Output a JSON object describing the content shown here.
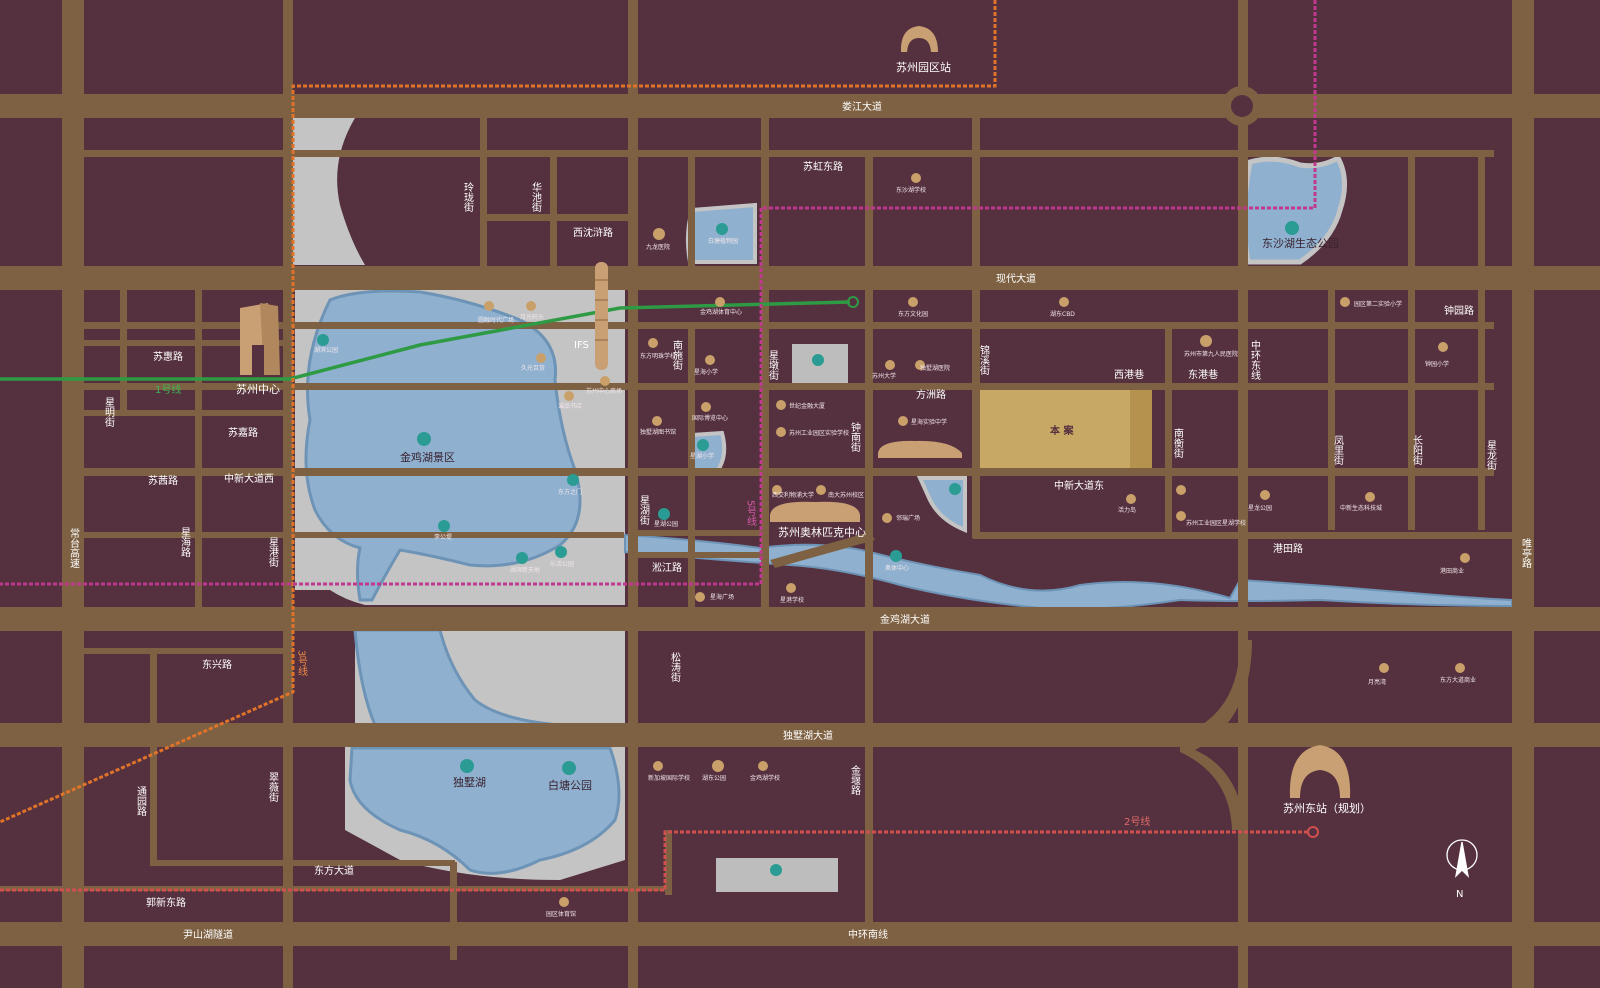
{
  "map": {
    "compass_letter": "N",
    "project_label": "本 案",
    "ifs_label": "IFS",
    "colors": {
      "background": "#55303e",
      "road": "#7e6142",
      "lake": "#8fb1cf",
      "lake_edge": "#6d93b6",
      "park": "#c4c4c4",
      "project": "#c8a865",
      "metro_line_1": "#2f9a44",
      "metro_line_2": "#d24f4f",
      "metro_line_3": "#e0732a",
      "metro_line_5": "#c0398f"
    },
    "roads_major": [
      "娄江大道",
      "现代大道",
      "金鸡湖大道",
      "独墅湖大道",
      "中环南线",
      "尹山湖隧道",
      "常台高速",
      "唯亭路"
    ],
    "roads_minor": [
      "苏虹东路",
      "西沈浒路",
      "苏惠路",
      "苏嘉路",
      "苏茜路",
      "中新大道西",
      "中新大道东",
      "方洲路",
      "西港巷",
      "东港巷",
      "钟园路",
      "港田路",
      "淞江路",
      "东兴路",
      "东方大道",
      "郭新东路",
      "星明街",
      "星海路",
      "星港街",
      "玲珑街",
      "华池街",
      "南施街",
      "星湖街",
      "星墩街",
      "钟南街",
      "锦溪街",
      "南衡街",
      "中环东线",
      "凤里街",
      "长阳街",
      "星龙街",
      "松涛街",
      "金堰路",
      "翠薇街",
      "通园路"
    ],
    "landmarks": [
      "苏州园区站",
      "苏州中心",
      "金鸡湖景区",
      "苏州奥林匹克中心",
      "东沙湖生态公园",
      "独墅湖",
      "白塘公园",
      "苏州东站（规划）"
    ],
    "metro_labels": [
      "1号线",
      "2号线",
      "3号线",
      "5号线"
    ],
    "poi_small": [
      "湖滨公园",
      "圆融时代广场",
      "月光码头",
      "久光百货",
      "苏州中心商场",
      "诚品书店",
      "李公堤",
      "湖滨新天地",
      "乐活公园",
      "东方之门",
      "金鸡湖体育中心",
      "九龙医院",
      "白塘植物园",
      "东方明珠学校",
      "星海小学",
      "国际博览中心",
      "独墅湖图书馆",
      "星湖小学",
      "世纪金融大厦",
      "苏州工业园区实验学校",
      "星海实验中学",
      "苏州大学",
      "独墅湖医院",
      "西交利物浦大学",
      "南大苏州校区",
      "星湖公园",
      "奥体中心",
      "邻瑞广场",
      "星海广场",
      "星港学校",
      "东沙湖学校",
      "东方文化园",
      "湖东CBD",
      "苏州市第九人民医院",
      "园区第二实验小学",
      "钟园小学",
      "中新生态科技城",
      "星龙公园",
      "港田商业",
      "月亮湾",
      "东方大道商业",
      "活力岛",
      "苏州工业园区星湖学校",
      "新加坡国际学校",
      "湖东公园",
      "金鸡湖学校",
      "园区体育馆"
    ]
  }
}
